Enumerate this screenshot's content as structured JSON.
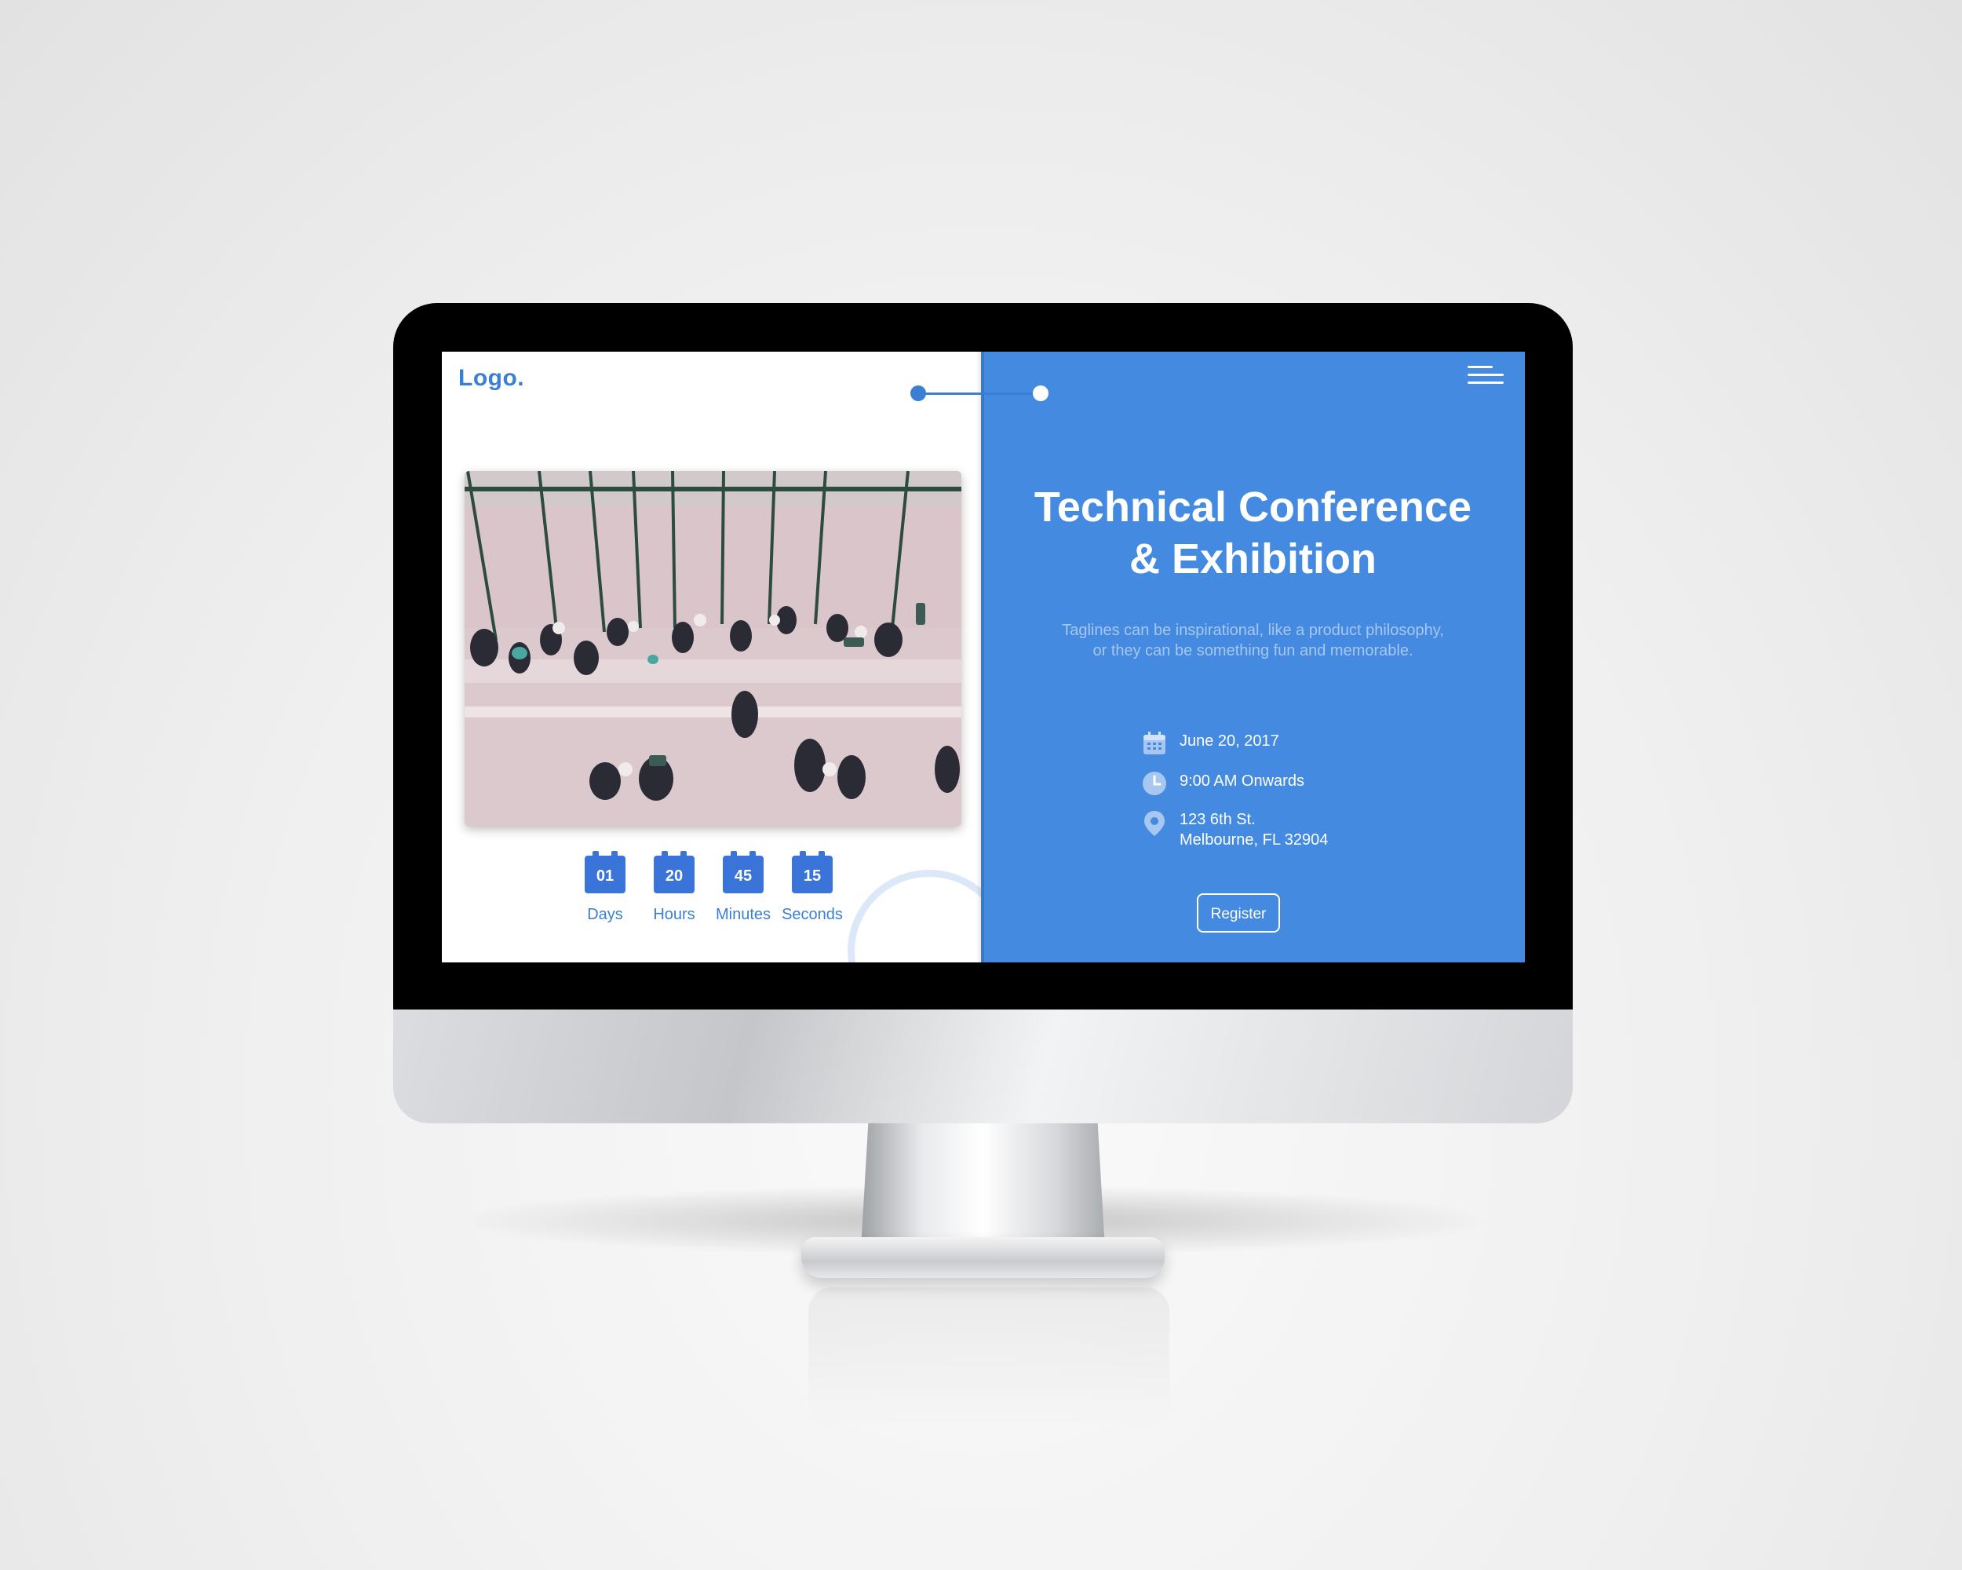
{
  "logo": {
    "text": "Logo."
  },
  "hero": {
    "title_line1": "Technical Conference",
    "title_line2": "& Exhibition",
    "tagline_line1": "Taglines can be inspirational, like a product philosophy,",
    "tagline_line2": "or they can be something fun and memorable."
  },
  "event": {
    "date": "June 20, 2017",
    "time": "9:00 AM Onwards",
    "address_line1": "123 6th St.",
    "address_line2": "Melbourne, FL 32904"
  },
  "register_label": "Register",
  "countdown": [
    {
      "value": "01",
      "label": "Days"
    },
    {
      "value": "20",
      "label": "Hours"
    },
    {
      "value": "45",
      "label": "Minutes"
    },
    {
      "value": "15",
      "label": "Seconds"
    }
  ],
  "colors": {
    "accent": "#438ae0",
    "countdown_box": "#3a74d9",
    "logo": "#3a7fd3",
    "tagline": "#a7c7f0"
  },
  "icons": {
    "menu": "hamburger-menu-icon",
    "date": "calendar-icon",
    "time": "clock-icon",
    "location": "map-pin-icon"
  }
}
